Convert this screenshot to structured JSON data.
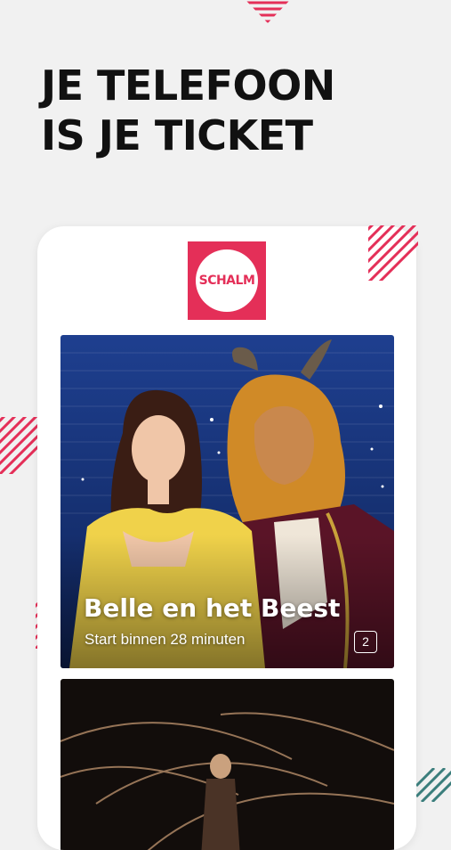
{
  "headline": {
    "line1": "JE TELEFOON",
    "line2": "IS JE TICKET"
  },
  "app": {
    "logo_text": "SCHALM"
  },
  "events": [
    {
      "title": "Belle en het Beest",
      "status": "Start binnen 28 minuten",
      "ticket_count": "2"
    },
    {
      "title": "",
      "status": "",
      "ticket_count": ""
    }
  ],
  "colors": {
    "accent": "#e42f58",
    "teal": "#3b7e7c",
    "background": "#f1f1f1"
  }
}
